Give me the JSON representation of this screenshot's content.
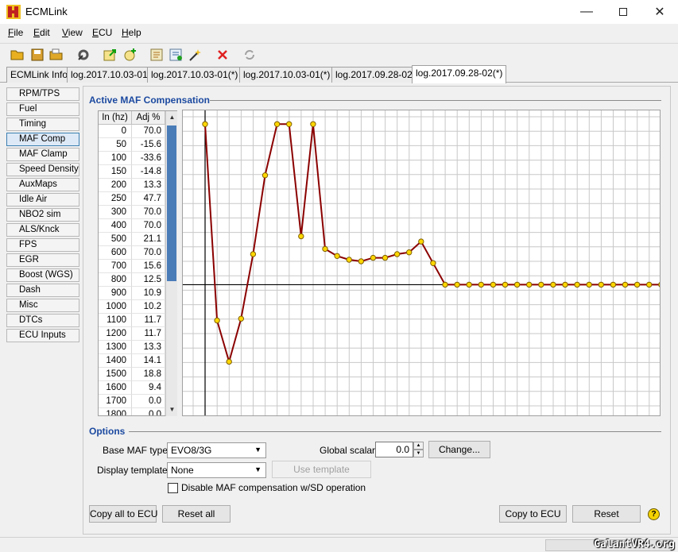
{
  "window": {
    "title": "ECMLink"
  },
  "menu": {
    "items": [
      {
        "label": "File",
        "underline": "F",
        "rest": "ile"
      },
      {
        "label": "Edit",
        "underline": "E",
        "rest": "dit"
      },
      {
        "label": "View",
        "underline": "V",
        "rest": "iew"
      },
      {
        "label": "ECU",
        "underline": "E",
        "rest": "CU"
      },
      {
        "label": "Help",
        "underline": "H",
        "rest": "elp"
      }
    ]
  },
  "toolbar": {
    "icons": [
      "open-folder-icon",
      "save-icon",
      "open-recent-icon",
      "tools-icon",
      "export-icon",
      "add-icon",
      "edit-log-icon",
      "convert-icon",
      "wand-icon",
      "delete-icon",
      "refresh-icon"
    ],
    "colors": {
      "delete": "#e02020",
      "folder": "#e8b020"
    }
  },
  "tabs": [
    {
      "label": "ECMLink Info"
    },
    {
      "label": "log.2017.10.03-01"
    },
    {
      "label": "log.2017.10.03-01(*)"
    },
    {
      "label": "log.2017.10.03-01(*)"
    },
    {
      "label": "log.2017.09.28-02"
    },
    {
      "label": "log.2017.09.28-02(*)"
    }
  ],
  "sidebar": {
    "items": [
      {
        "label": "RPM/TPS"
      },
      {
        "label": "Fuel"
      },
      {
        "label": "Timing"
      },
      {
        "label": "MAF Comp"
      },
      {
        "label": "MAF Clamp"
      },
      {
        "label": "Speed Density"
      },
      {
        "label": "AuxMaps"
      },
      {
        "label": "Idle Air"
      },
      {
        "label": "NBO2 sim"
      },
      {
        "label": "ALS/Knck"
      },
      {
        "label": "FPS"
      },
      {
        "label": "EGR"
      },
      {
        "label": "Boost (WGS)"
      },
      {
        "label": "Dash"
      },
      {
        "label": "Misc"
      },
      {
        "label": "DTCs"
      },
      {
        "label": "ECU Inputs"
      }
    ],
    "active_index": 3
  },
  "main": {
    "section_title": "Active MAF Compensation",
    "table": {
      "headers": [
        "In (hz)",
        "Adj %"
      ],
      "rows": [
        [
          "0",
          "70.0"
        ],
        [
          "50",
          "-15.6"
        ],
        [
          "100",
          "-33.6"
        ],
        [
          "150",
          "-14.8"
        ],
        [
          "200",
          "13.3"
        ],
        [
          "250",
          "47.7"
        ],
        [
          "300",
          "70.0"
        ],
        [
          "400",
          "70.0"
        ],
        [
          "500",
          "21.1"
        ],
        [
          "600",
          "70.0"
        ],
        [
          "700",
          "15.6"
        ],
        [
          "800",
          "12.5"
        ],
        [
          "900",
          "10.9"
        ],
        [
          "1000",
          "10.2"
        ],
        [
          "1100",
          "11.7"
        ],
        [
          "1200",
          "11.7"
        ],
        [
          "1300",
          "13.3"
        ],
        [
          "1400",
          "14.1"
        ],
        [
          "1500",
          "18.8"
        ],
        [
          "1600",
          "9.4"
        ],
        [
          "1700",
          "0.0"
        ],
        [
          "1800",
          "0.0"
        ]
      ]
    }
  },
  "chart_data": {
    "type": "line",
    "x": [
      0,
      50,
      100,
      150,
      200,
      250,
      300,
      400,
      500,
      600,
      700,
      800,
      900,
      1000,
      1100,
      1200,
      1300,
      1400,
      1500,
      1600,
      1700,
      1800,
      1900,
      2000,
      2100,
      2200,
      2300,
      2400,
      2500,
      2600,
      2700,
      2800,
      2900,
      3000,
      3100,
      3200,
      3300,
      3400,
      3500,
      3600
    ],
    "series": [
      {
        "values": [
          70.0,
          -15.6,
          -33.6,
          -14.8,
          13.3,
          47.7,
          70.0,
          70.0,
          21.1,
          70.0,
          15.6,
          12.5,
          10.9,
          10.2,
          11.7,
          11.7,
          13.3,
          14.1,
          18.8,
          9.4,
          0.0,
          0.0,
          0.0,
          0.0,
          0.0,
          0.0,
          0.0,
          0.0,
          0.0,
          0.0,
          0.0,
          0.0,
          0.0,
          0.0,
          0.0,
          0.0,
          0.0,
          0.0,
          0.0,
          0.0
        ]
      }
    ],
    "ylim": [
      -57,
      76
    ],
    "grid": true,
    "colors": {
      "line": "#8b0000",
      "point_fill": "#ffd700",
      "point_stroke": "#806000",
      "grid": "#c8c8c8",
      "axis": "#000000"
    }
  },
  "options": {
    "section_title": "Options",
    "base_maf_type": {
      "label": "Base MAF type:",
      "value": "EVO8/3G"
    },
    "global_scalar": {
      "label": "Global scalar:",
      "value": "0.0"
    },
    "change_button": "Change...",
    "display_template": {
      "label": "Display template:",
      "value": "None"
    },
    "use_template_button": "Use template",
    "disable_checkbox": {
      "label": "Disable MAF compensation w/SD operation",
      "checked": false
    }
  },
  "bottom_buttons": {
    "copy_all": "Copy all to ECU",
    "reset_all": "Reset all",
    "copy": "Copy to ECU",
    "reset": "Reset",
    "help": "?"
  },
  "watermark": "GalantVR4.org"
}
